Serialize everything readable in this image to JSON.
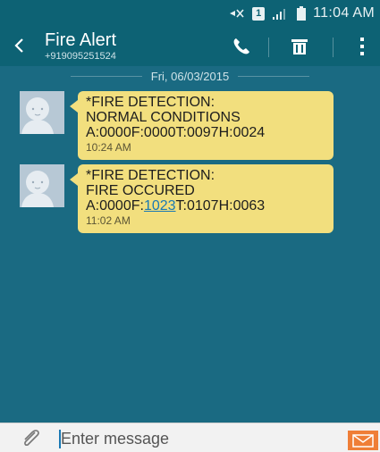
{
  "status_bar": {
    "time": "11:04 AM",
    "sim_label": "1",
    "icons": [
      "mute-icon",
      "sim-icon",
      "signal-icon",
      "battery-icon"
    ]
  },
  "action_bar": {
    "contact_name": "Fire Alert",
    "contact_number": "+919095251524",
    "icons": [
      "back-icon",
      "call-icon",
      "trash-icon",
      "more-vertical-icon"
    ]
  },
  "conversation": {
    "date": "Fri, 06/03/2015",
    "messages": [
      {
        "lines": [
          "*FIRE DETECTION:",
          "NORMAL CONDITIONS",
          "A:0000F:0000T:0097H:0024"
        ],
        "time": "10:24 AM"
      },
      {
        "lines": [
          "*FIRE DETECTION:",
          "FIRE OCCURED"
        ],
        "line3_prefix": "A:0000F:",
        "line3_link": "1023",
        "line3_suffix": "T:0107H:0063",
        "time": "11:02 AM"
      }
    ]
  },
  "compose": {
    "placeholder": "Enter message",
    "icons": [
      "paperclip-icon",
      "send-icon"
    ]
  },
  "colors": {
    "header": "#0d6274",
    "background": "#1a6a82",
    "bubble": "#f2df7e",
    "send_button": "#ef7e37"
  }
}
